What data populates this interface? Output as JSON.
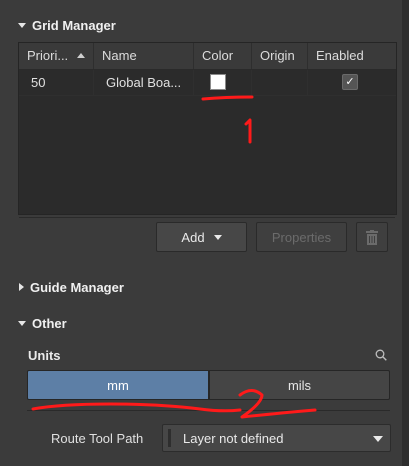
{
  "grid_manager": {
    "title": "Grid Manager",
    "columns": [
      "Priori...",
      "Name",
      "Color",
      "Origin",
      "Enabled"
    ],
    "rows": [
      {
        "priority": "50",
        "name": "Global Boa...",
        "color": "#ffffff",
        "origin": "",
        "enabled": "✓"
      }
    ],
    "add_label": "Add",
    "properties_label": "Properties",
    "delete_icon": "trash-icon"
  },
  "guide_manager": {
    "title": "Guide Manager"
  },
  "other": {
    "title": "Other",
    "units_label": "Units",
    "units_options": [
      "mm",
      "mils"
    ],
    "units_selected": "mm",
    "route_tool_path_label": "Route Tool Path",
    "route_tool_path_value": "Layer not defined"
  },
  "annotations": {
    "mark_1": "1",
    "mark_2": "2",
    "color": "#ff1a1a"
  },
  "colors": {
    "background": "#3b3b3b",
    "selected_toggle": "#5d7fa6"
  }
}
